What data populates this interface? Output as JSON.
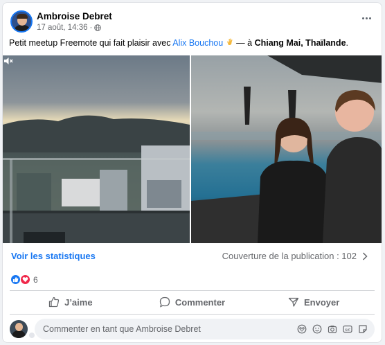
{
  "post": {
    "author": "Ambroise Debret",
    "timestamp": "17 août, 14:36",
    "separator": "·",
    "caption": {
      "prefix": "Petit meetup Freemote qui fait plaisir avec ",
      "mention": "Alix Bouchou",
      "middle": " — à ",
      "place": "Chiang Mai, Thaïlande",
      "suffix": "."
    }
  },
  "stats": {
    "link_label": "Voir les statistiques",
    "reach_label": "Couverture de la publication : 102"
  },
  "reactions": {
    "count": "6",
    "types": [
      "like",
      "love"
    ]
  },
  "actions": {
    "like": "J’aime",
    "comment": "Commenter",
    "share": "Envoyer"
  },
  "comment": {
    "placeholder": "Commenter en tant que Ambroise Debret"
  },
  "colors": {
    "accent": "#1877f2",
    "love": "#f0284a",
    "muted": "#65676b"
  },
  "icons": [
    "globe-icon",
    "more-icon",
    "mute-icon",
    "chevron-right-icon",
    "like-icon",
    "comment-icon",
    "send-icon",
    "avatar-sticker-icon",
    "emoji-icon",
    "camera-icon",
    "gif-icon",
    "sticker-icon"
  ]
}
